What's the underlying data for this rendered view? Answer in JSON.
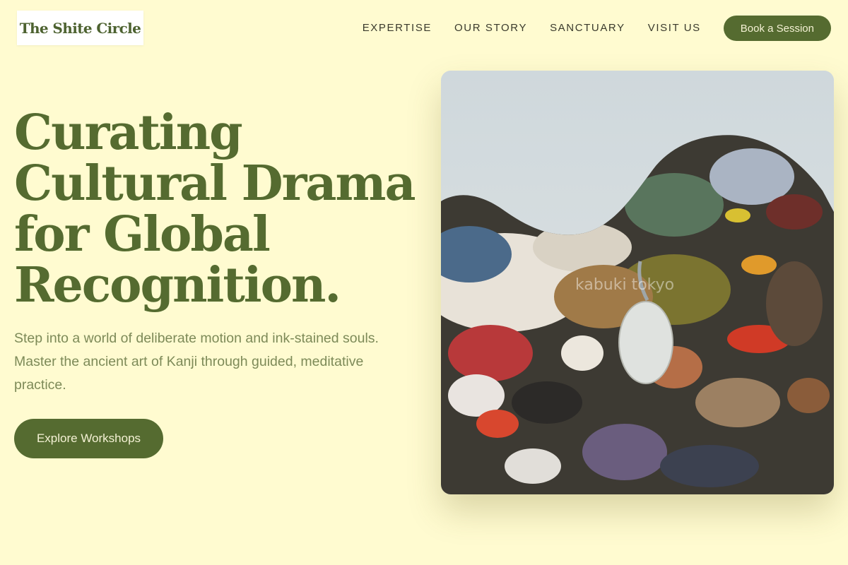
{
  "brand": {
    "name": "The Shite Circle"
  },
  "nav": {
    "links": [
      "EXPERTISE",
      "OUR STORY",
      "SANCTUARY",
      "VISIT US"
    ],
    "cta_label": "Book a Session"
  },
  "hero": {
    "title_lines": [
      "Curating",
      "Cultural Drama",
      "for Global",
      "Recognition."
    ],
    "description": "Step into a world of deliberate motion and ink-stained souls. Master the ancient art of Kanji through guided, meditative practice.",
    "cta_label": "Explore Workshops"
  },
  "image": {
    "subject": "paint-palette-photo",
    "watermark": "kabuki tokyo"
  },
  "colors": {
    "background": "#fffbd0",
    "accent": "#556b30",
    "text": "#3a3a2c",
    "muted": "#7d8a58"
  }
}
